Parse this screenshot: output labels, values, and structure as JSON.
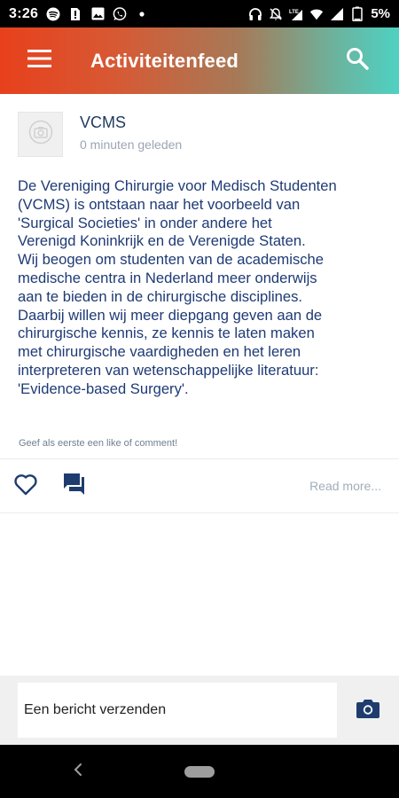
{
  "status_bar": {
    "time": "3:26",
    "battery_text": "5%",
    "left_icons": [
      "spotify-icon",
      "sim-icon",
      "image-icon",
      "whatsapp-icon",
      "dot-icon"
    ],
    "right_icons": [
      "headphones-icon",
      "vibrate-off-icon",
      "signal-lte-icon",
      "wifi-icon",
      "signal-icon",
      "battery-icon"
    ]
  },
  "app_bar": {
    "title": "Activiteitenfeed",
    "menu_icon": "menu-icon",
    "search_icon": "search-icon",
    "gradient_colors": [
      "#e8401c",
      "#4fd1c2"
    ]
  },
  "post": {
    "author": "VCMS",
    "time_ago": "0 minuten geleden",
    "body_lines": [
      "De Vereniging Chirurgie voor Medisch Studenten",
      "(VCMS) is ontstaan naar het voorbeeld van",
      "'Surgical Societies' in onder andere het",
      "Verenigd Koninkrijk en de Verenigde Staten.",
      "Wij beogen om studenten van de academische",
      "medische centra in Nederland meer onderwijs",
      "aan te bieden in de chirurgische disciplines.",
      "Daarbij willen wij meer diepgang geven aan de",
      "chirurgische kennis, ze kennis te laten maken",
      "met chirurgische vaardigheden en het leren",
      "interpreteren van wetenschappelijke literatuur:",
      "'Evidence-based Surgery'."
    ],
    "like_hint": "Geef als eerste een like of comment!",
    "read_more": "Read more..."
  },
  "composer": {
    "placeholder": "Een bericht verzenden",
    "camera_icon": "camera-icon"
  },
  "colors": {
    "primary_text": "#1e3a75",
    "icon_navy": "#1f3c6e",
    "muted": "#9aa6b2"
  }
}
